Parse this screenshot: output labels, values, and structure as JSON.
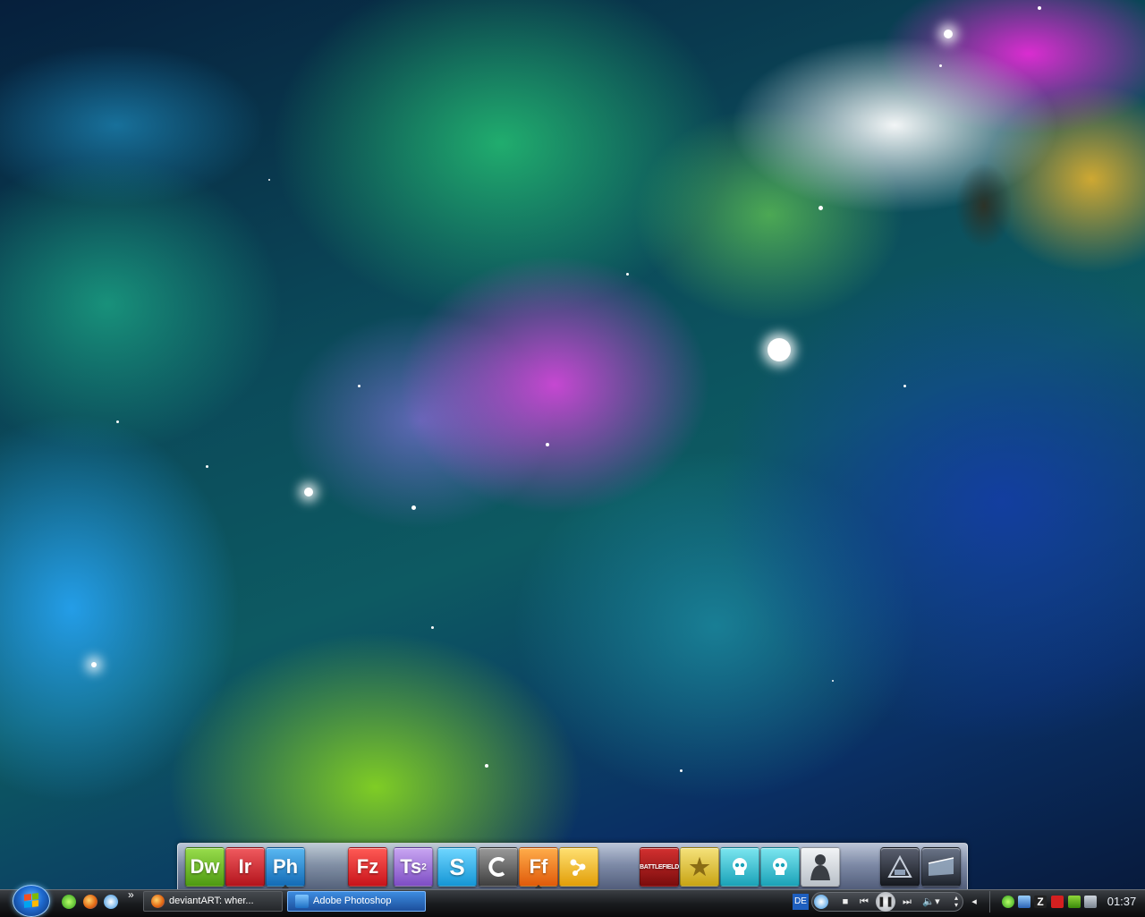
{
  "dock": {
    "apps": [
      {
        "label": "Dw",
        "name": "dreamweaver",
        "color": "#6fbf1c"
      },
      {
        "label": "Ir",
        "name": "imageready",
        "color": "#d6262f"
      },
      {
        "label": "Ph",
        "name": "photoshop",
        "color": "#1f8ad6",
        "running": true
      },
      {
        "label": "Fz",
        "name": "filezilla",
        "color": "#e0282c"
      },
      {
        "label": "Ts",
        "sup": "2",
        "name": "teamspeak",
        "color": "#9a6fd6"
      },
      {
        "label": "S",
        "name": "skype",
        "color": "#27b4ea"
      },
      {
        "label": "",
        "name": "ccleaner",
        "color": "#6b6b6b"
      },
      {
        "label": "Ff",
        "name": "firefox",
        "color": "#f07a18",
        "running": true
      },
      {
        "label": "",
        "name": "molecule",
        "color": "#f2b818"
      },
      {
        "label": "BATTLEFIELD",
        "name": "battlefield-2",
        "color": "#b21a1a"
      },
      {
        "label": "",
        "name": "star-game",
        "color": "#e8c830"
      },
      {
        "label": "",
        "name": "skull-game-1",
        "color": "#2cc0d0"
      },
      {
        "label": "",
        "name": "skull-game-2",
        "color": "#2cc0d0"
      },
      {
        "label": "",
        "name": "character-game",
        "color": "#d8dde2"
      },
      {
        "label": "",
        "name": "computer",
        "color": "#2a2f38"
      },
      {
        "label": "",
        "name": "recycle-bin",
        "color": "#3a4250"
      }
    ]
  },
  "taskbar": {
    "tasks": [
      {
        "title": "deviantART: wher...",
        "active": false
      },
      {
        "title": "Adobe Photoshop",
        "active": true
      }
    ],
    "overflow_chevron": "»",
    "lang_indicator": "DE",
    "clock": "01:37"
  },
  "colors": {
    "taskbar": "#1a1c1f",
    "active_task": "#2f76c8"
  }
}
